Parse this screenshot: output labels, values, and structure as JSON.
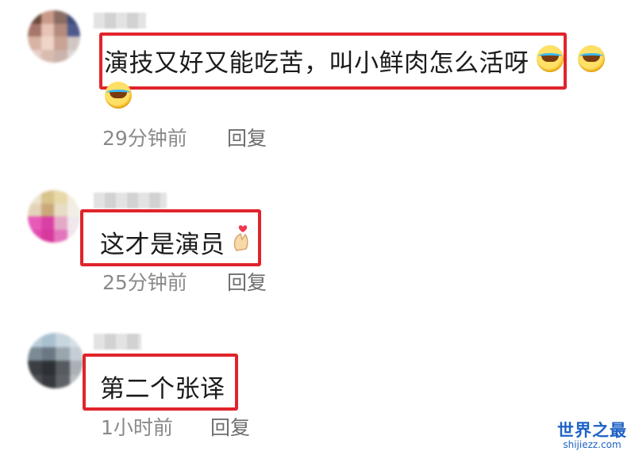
{
  "comments": [
    {
      "text": "演技又好又能吃苦，叫小鲜肉怎么活呀",
      "time": "29分钟前",
      "reply": "回复",
      "emojis": [
        "rolling-laugh-emoji",
        "rolling-laugh-emoji",
        "rolling-laugh-emoji"
      ]
    },
    {
      "text": "这才是演员",
      "time": "25分钟前",
      "reply": "回复",
      "emojis": [
        "finger-heart-emoji"
      ]
    },
    {
      "text": "第二个张译",
      "time": "1小时前",
      "reply": "回复",
      "emojis": []
    }
  ],
  "highlight_color": "#e0242c",
  "watermark": {
    "title": "世界之最",
    "url": "shijiezz.com",
    "color": "#1d62c6"
  }
}
